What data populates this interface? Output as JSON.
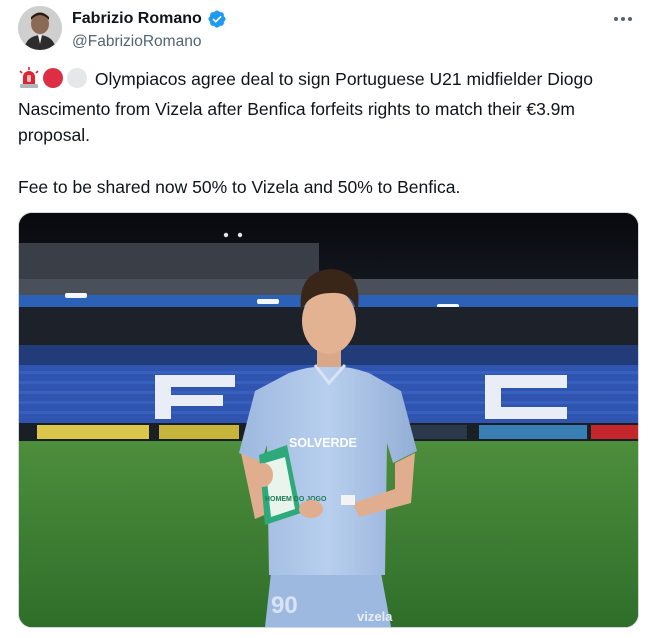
{
  "author": {
    "name": "Fabrizio Romano",
    "handle": "@FabrizioRomano",
    "verified": true
  },
  "more_icon": "more-horizontal-icon",
  "emoji_prefix": [
    "rotating-light-emoji",
    "red-circle-emoji",
    "white-circle-emoji"
  ],
  "text": {
    "paragraph1": "Olympiacos agree deal to sign Portuguese U21 midfielder Diogo Nascimento from Vizela after Benfica forfeits rights to match their €3.9m proposal.",
    "paragraph2": "Fee to be shared now 50% to Vizela and 50% to Benfica."
  },
  "media": {
    "sponsor": "SOLVERDE",
    "shirt_number": "90",
    "award_text": "HOMEM DO JOGO",
    "shorts_text": "vizela"
  },
  "colors": {
    "verified_blue": "#1d9bf0",
    "pitch_green": "#3f8a3a",
    "kit_blue": "#a9c3e6",
    "stand_blue": "#2b4fa8"
  }
}
